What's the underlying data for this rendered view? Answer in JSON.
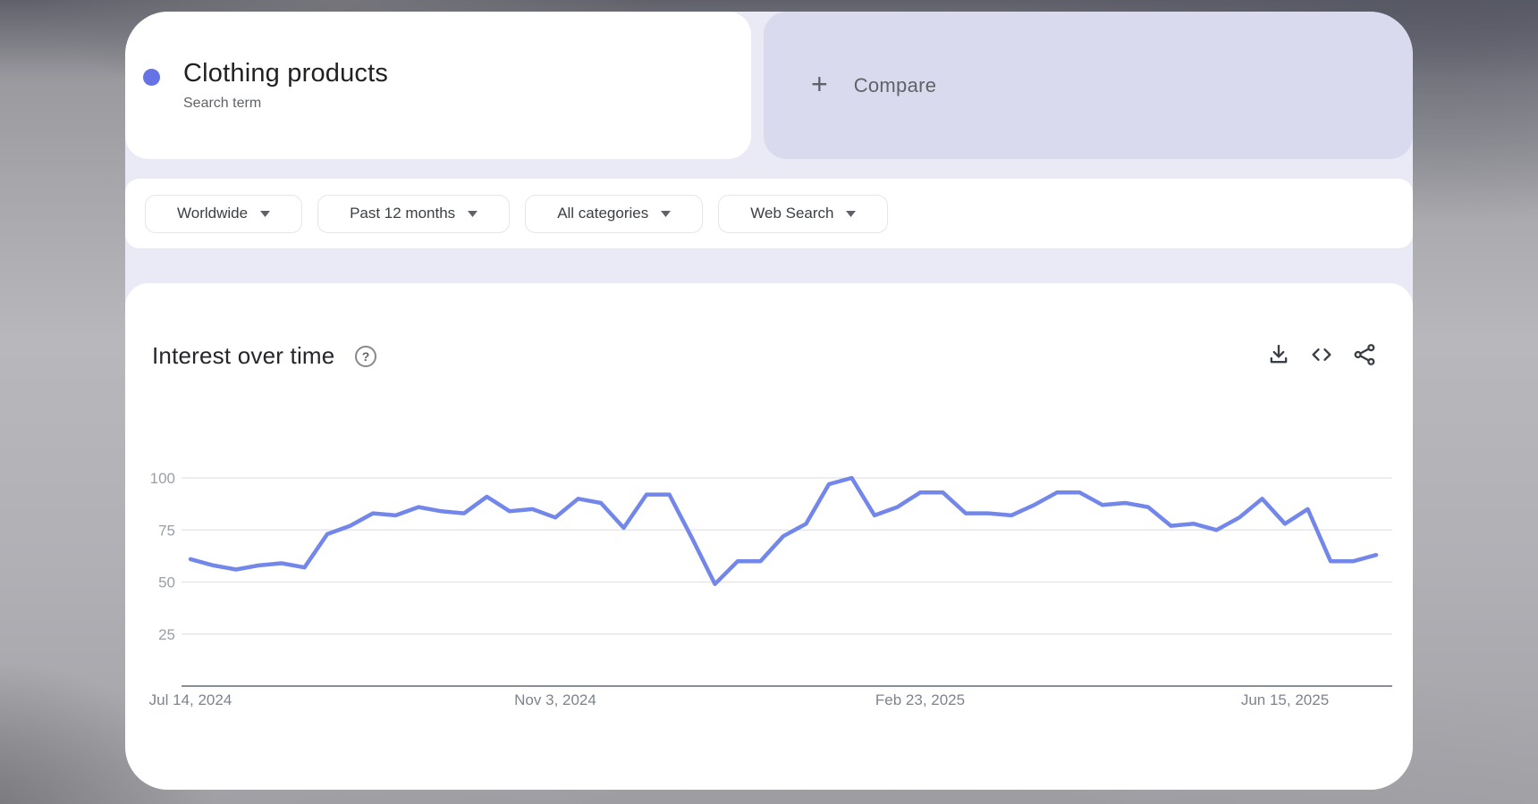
{
  "term_card": {
    "title": "Clothing products",
    "subtitle": "Search term",
    "dot_color": "#6573e5"
  },
  "compare_card": {
    "plus": "+",
    "label": "Compare"
  },
  "filter_bar": {
    "region": "Worldwide",
    "time": "Past 12 months",
    "category": "All categories",
    "search_type": "Web Search"
  },
  "widget": {
    "title": "Interest over time",
    "help_glyph": "?",
    "actions": [
      "download",
      "embed-code",
      "share"
    ]
  },
  "chart_data": {
    "type": "line",
    "title": "Interest over time",
    "legend": "none",
    "grid": "horizontal",
    "ylim": [
      0,
      100
    ],
    "y_ticks": [
      100,
      75,
      50,
      25
    ],
    "x_tick_labels": [
      "Jul 14, 2024",
      "Nov 3, 2024",
      "Feb 23, 2025",
      "Jun 15, 2025"
    ],
    "x_tick_indices": [
      0,
      16,
      32,
      48
    ],
    "x": [
      "Jul 14, 2024",
      "Jul 21, 2024",
      "Jul 28, 2024",
      "Aug 4, 2024",
      "Aug 11, 2024",
      "Aug 18, 2024",
      "Aug 25, 2024",
      "Sep 1, 2024",
      "Sep 8, 2024",
      "Sep 15, 2024",
      "Sep 22, 2024",
      "Sep 29, 2024",
      "Oct 6, 2024",
      "Oct 13, 2024",
      "Oct 20, 2024",
      "Oct 27, 2024",
      "Nov 3, 2024",
      "Nov 10, 2024",
      "Nov 17, 2024",
      "Nov 24, 2024",
      "Dec 1, 2024",
      "Dec 8, 2024",
      "Dec 15, 2024",
      "Dec 22, 2024",
      "Dec 29, 2024",
      "Jan 5, 2025",
      "Jan 12, 2025",
      "Jan 19, 2025",
      "Jan 26, 2025",
      "Feb 2, 2025",
      "Feb 9, 2025",
      "Feb 16, 2025",
      "Feb 23, 2025",
      "Mar 2, 2025",
      "Mar 9, 2025",
      "Mar 16, 2025",
      "Mar 23, 2025",
      "Mar 30, 2025",
      "Apr 6, 2025",
      "Apr 13, 2025",
      "Apr 20, 2025",
      "Apr 27, 2025",
      "May 4, 2025",
      "May 11, 2025",
      "May 18, 2025",
      "May 25, 2025",
      "Jun 1, 2025",
      "Jun 8, 2025",
      "Jun 15, 2025",
      "Jun 22, 2025",
      "Jun 29, 2025",
      "Jul 6, 2025",
      "Jul 13, 2025"
    ],
    "series": [
      {
        "name": "Clothing products",
        "color": "#7287e9",
        "values": [
          61,
          58,
          56,
          58,
          59,
          57,
          73,
          77,
          83,
          82,
          86,
          84,
          83,
          91,
          84,
          85,
          81,
          90,
          88,
          76,
          92,
          92,
          71,
          49,
          60,
          60,
          72,
          78,
          97,
          100,
          82,
          86,
          93,
          93,
          83,
          83,
          82,
          87,
          93,
          93,
          87,
          88,
          86,
          77,
          78,
          75,
          81,
          90,
          78,
          85,
          60,
          60,
          63
        ]
      }
    ],
    "axis_color": "#8b9096",
    "grid_color": "#e1e3e8",
    "y_label_color": "#9aa0a6",
    "x_label_color": "#7e848b"
  }
}
